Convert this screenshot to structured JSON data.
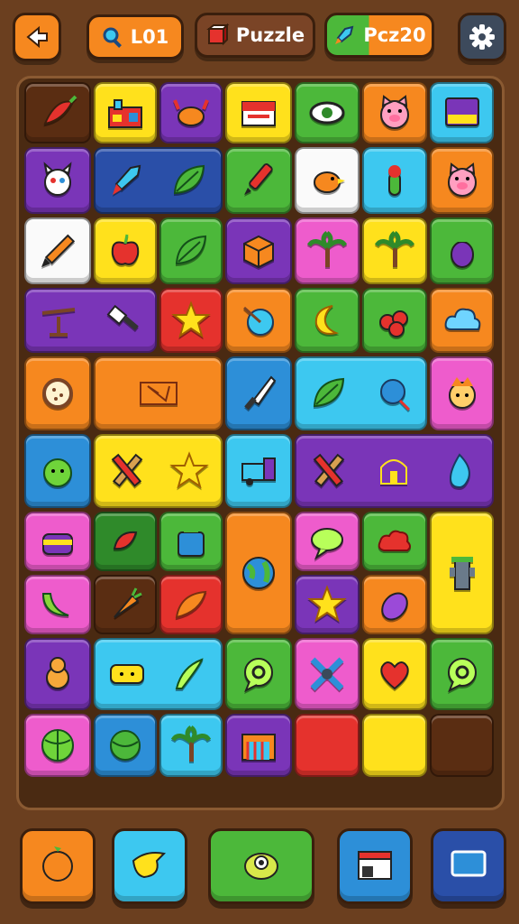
{
  "colors": {
    "orange": "#f6881f",
    "blue": "#2d8fd8",
    "red": "#e5322d",
    "green": "#4cb83a",
    "purple": "#7a35b8",
    "yellow": "#ffe11c",
    "pink": "#ee5ccc",
    "cyan": "#3dc8f0",
    "darkred": "#7a2e10",
    "white": "#fafafa",
    "darkgreen": "#2f8a2a",
    "brown": "#5a2d12",
    "navy": "#2a4fa8",
    "dark": "#3a1f0d"
  },
  "topbar": {
    "back_icon": "back-arrow-icon",
    "level": {
      "icon": "magnifier-icon",
      "label": "L01"
    },
    "mode": {
      "icon": "cube-icon",
      "label": "Puzzle"
    },
    "score": {
      "icon": "rocket-icon",
      "label": "Pcz20"
    },
    "settings_icon": "gear-icon"
  },
  "board": {
    "tiles": [
      {
        "name": "tile-pepper",
        "color": "brown",
        "icons": [
          "pepper"
        ]
      },
      {
        "name": "tile-factory",
        "color": "yellow",
        "icons": [
          "factory"
        ]
      },
      {
        "name": "tile-crab",
        "color": "purple",
        "icons": [
          "crab"
        ]
      },
      {
        "name": "tile-flag",
        "color": "yellow",
        "icons": [
          "flag"
        ]
      },
      {
        "name": "tile-eye",
        "color": "green",
        "icons": [
          "eye"
        ]
      },
      {
        "name": "tile-pig",
        "color": "orange",
        "icons": [
          "pig"
        ]
      },
      {
        "name": "tile-screen",
        "color": "cyan",
        "icons": [
          "screen"
        ]
      },
      {
        "name": "tile-cat",
        "color": "purple",
        "icons": [
          "cat"
        ]
      },
      {
        "name": "tile-rocket-leaf",
        "color": "navy",
        "icons": [
          "rocket",
          "leaf"
        ]
      },
      {
        "name": "tile-pen",
        "color": "green",
        "icons": [
          "pen"
        ]
      },
      {
        "name": "tile-bird",
        "color": "white",
        "icons": [
          "bird"
        ]
      },
      {
        "name": "tile-plant",
        "color": "cyan",
        "icons": [
          "cactus"
        ]
      },
      {
        "name": "tile-pig-face",
        "color": "orange",
        "icons": [
          "pig"
        ]
      },
      {
        "name": "tile-pencil",
        "color": "white",
        "icons": [
          "pencil"
        ]
      },
      {
        "name": "tile-apple",
        "color": "yellow",
        "icons": [
          "apple"
        ]
      },
      {
        "name": "tile-leaf",
        "color": "green",
        "icons": [
          "leaf"
        ]
      },
      {
        "name": "tile-box",
        "color": "purple",
        "icons": [
          "box"
        ]
      },
      {
        "name": "tile-palm-pink",
        "color": "pink",
        "icons": [
          "palm"
        ]
      },
      {
        "name": "tile-palm-yellow",
        "color": "yellow",
        "icons": [
          "palm"
        ]
      },
      {
        "name": "tile-eggplant",
        "color": "green",
        "icons": [
          "eggplant"
        ]
      },
      {
        "name": "tile-windmill-brush",
        "color": "purple",
        "icons": [
          "windmill",
          "brush"
        ]
      },
      {
        "name": "tile-star",
        "color": "red",
        "icons": [
          "star"
        ]
      },
      {
        "name": "tile-globe",
        "color": "orange",
        "icons": [
          "globe"
        ]
      },
      {
        "name": "tile-moon",
        "color": "green",
        "icons": [
          "moon"
        ]
      },
      {
        "name": "tile-berries",
        "color": "green",
        "icons": [
          "berries"
        ]
      },
      {
        "name": "tile-cloud",
        "color": "orange",
        "icons": [
          "cloud"
        ]
      },
      {
        "name": "tile-cookie",
        "color": "orange",
        "icons": [
          "cookie"
        ]
      },
      {
        "name": "tile-explosion",
        "color": "orange",
        "icons": [
          "explosion"
        ]
      },
      {
        "name": "tile-knife",
        "color": "blue",
        "icons": [
          "knife"
        ]
      },
      {
        "name": "tile-leaf-balloon",
        "color": "cyan",
        "icons": [
          "leaf",
          "balloon"
        ]
      },
      {
        "name": "tile-monkey",
        "color": "pink",
        "icons": [
          "monkey"
        ]
      },
      {
        "name": "tile-slime",
        "color": "blue",
        "icons": [
          "slime"
        ]
      },
      {
        "name": "tile-tools-star",
        "color": "yellow",
        "icons": [
          "tools",
          "star"
        ]
      },
      {
        "name": "tile-truck",
        "color": "cyan",
        "icons": [
          "truck"
        ]
      },
      {
        "name": "tile-tools-temple-flame",
        "color": "purple",
        "icons": [
          "tools",
          "temple",
          "flame"
        ]
      },
      {
        "name": "tile-cake",
        "color": "pink",
        "icons": [
          "cake"
        ]
      },
      {
        "name": "tile-chili",
        "color": "darkgreen",
        "icons": [
          "chili"
        ]
      },
      {
        "name": "tile-jar",
        "color": "green",
        "icons": [
          "jar"
        ]
      },
      {
        "name": "tile-earth",
        "color": "orange",
        "icons": [
          "earth"
        ]
      },
      {
        "name": "tile-bubble",
        "color": "pink",
        "icons": [
          "bubble"
        ]
      },
      {
        "name": "tile-red-cloud",
        "color": "green",
        "icons": [
          "redcloud"
        ]
      },
      {
        "name": "tile-tower",
        "color": "yellow",
        "icons": [
          "tower"
        ]
      },
      {
        "name": "tile-banana",
        "color": "pink",
        "icons": [
          "banana"
        ]
      },
      {
        "name": "tile-carrot",
        "color": "brown",
        "icons": [
          "carrot"
        ]
      },
      {
        "name": "tile-feather",
        "color": "red",
        "icons": [
          "feather"
        ]
      },
      {
        "name": "tile-star-dark",
        "color": "purple",
        "icons": [
          "star"
        ]
      },
      {
        "name": "tile-plum",
        "color": "orange",
        "icons": [
          "plum"
        ]
      },
      {
        "name": "tile-bear",
        "color": "purple",
        "icons": [
          "bear"
        ]
      },
      {
        "name": "tile-sponge-cucumber",
        "color": "cyan",
        "icons": [
          "sponge",
          "cucumber"
        ]
      },
      {
        "name": "tile-chat",
        "color": "green",
        "icons": [
          "chat"
        ]
      },
      {
        "name": "tile-propeller",
        "color": "pink",
        "icons": [
          "propeller"
        ]
      },
      {
        "name": "tile-heart",
        "color": "yellow",
        "icons": [
          "heart"
        ]
      },
      {
        "name": "tile-chat-green",
        "color": "green",
        "icons": [
          "chat"
        ]
      },
      {
        "name": "tile-cabbage",
        "color": "pink",
        "icons": [
          "cabbage"
        ]
      },
      {
        "name": "tile-ball",
        "color": "blue",
        "icons": [
          "ball"
        ]
      },
      {
        "name": "tile-palm-cyan",
        "color": "cyan",
        "icons": [
          "palm"
        ]
      },
      {
        "name": "tile-gate",
        "color": "purple",
        "icons": [
          "gate"
        ]
      },
      {
        "name": "tile-empty-red",
        "color": "red",
        "icons": []
      },
      {
        "name": "tile-empty-yellow",
        "color": "yellow",
        "icons": []
      },
      {
        "name": "tile-empty-brown",
        "color": "brown",
        "icons": []
      }
    ]
  },
  "bottombar": {
    "buttons": [
      {
        "name": "powerup-orange-fruit",
        "color": "orange",
        "icon": "orange-fruit-icon"
      },
      {
        "name": "powerup-bird",
        "color": "cyan",
        "icon": "bird-icon"
      },
      {
        "name": "powerup-monster",
        "color": "green",
        "icon": "monster-icon"
      },
      {
        "name": "powerup-shop",
        "color": "blue",
        "icon": "shop-icon"
      },
      {
        "name": "powerup-screen",
        "color": "navy",
        "icon": "screen-icon"
      }
    ]
  }
}
